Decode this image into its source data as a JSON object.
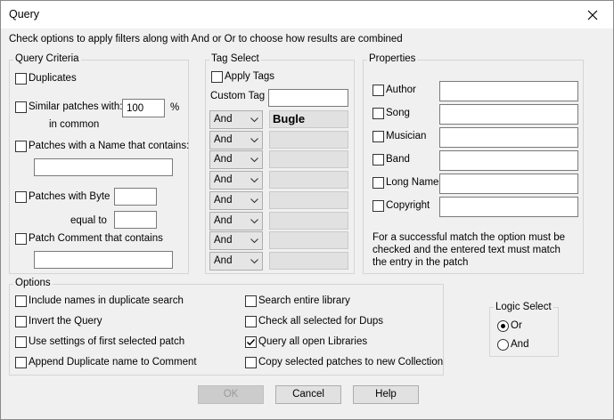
{
  "window": {
    "title": "Query"
  },
  "instructions": "Check options to apply filters along with And or Or to choose how results are combined",
  "query_criteria": {
    "legend": "Query Criteria",
    "duplicates_label": "Duplicates",
    "similar_label": "Similar patches with:",
    "similar_value": "100",
    "percent": "%",
    "in_common": "in common",
    "name_contains_label": "Patches with a Name that contains:",
    "name_contains_value": "",
    "byte_label": "Patches with Byte",
    "byte_value": "",
    "equal_to": "equal to",
    "equal_value": "",
    "comment_label": "Patch Comment that contains",
    "comment_value": ""
  },
  "tag_select": {
    "legend": "Tag Select",
    "apply_tags_label": "Apply Tags",
    "custom_tag_label": "Custom Tag",
    "custom_tag_value": "",
    "rows": [
      {
        "op": "And",
        "tag": "Bugle"
      },
      {
        "op": "And",
        "tag": ""
      },
      {
        "op": "And",
        "tag": ""
      },
      {
        "op": "And",
        "tag": ""
      },
      {
        "op": "And",
        "tag": ""
      },
      {
        "op": "And",
        "tag": ""
      },
      {
        "op": "And",
        "tag": ""
      },
      {
        "op": "And",
        "tag": ""
      }
    ]
  },
  "properties": {
    "legend": "Properties",
    "fields": [
      {
        "label": "Author",
        "value": ""
      },
      {
        "label": "Song",
        "value": ""
      },
      {
        "label": "Musician",
        "value": ""
      },
      {
        "label": "Band",
        "value": ""
      },
      {
        "label": "Long Name",
        "value": ""
      },
      {
        "label": "Copyright",
        "value": ""
      }
    ],
    "note": "For a successful match the option must be checked and the entered text must match the entry in the patch"
  },
  "options": {
    "legend": "Options",
    "left": [
      {
        "label": "Include names in duplicate search",
        "checked": false
      },
      {
        "label": "Invert the Query",
        "checked": false
      },
      {
        "label": "Use settings of first selected patch",
        "checked": false
      },
      {
        "label": "Append Duplicate name to Comment",
        "checked": false
      }
    ],
    "right": [
      {
        "label": "Search entire library",
        "checked": false
      },
      {
        "label": "Check all selected for Dups",
        "checked": false
      },
      {
        "label": "Query all open Libraries",
        "checked": true
      },
      {
        "label": "Copy selected patches to new Collection",
        "checked": false
      }
    ]
  },
  "logic_select": {
    "legend": "Logic Select",
    "or_label": "Or",
    "and_label": "And",
    "selected": "Or"
  },
  "buttons": {
    "ok": "OK",
    "cancel": "Cancel",
    "help": "Help"
  },
  "icons": {
    "close": "close-icon",
    "check": "check-icon",
    "dropdown": "chevron-down-icon"
  }
}
